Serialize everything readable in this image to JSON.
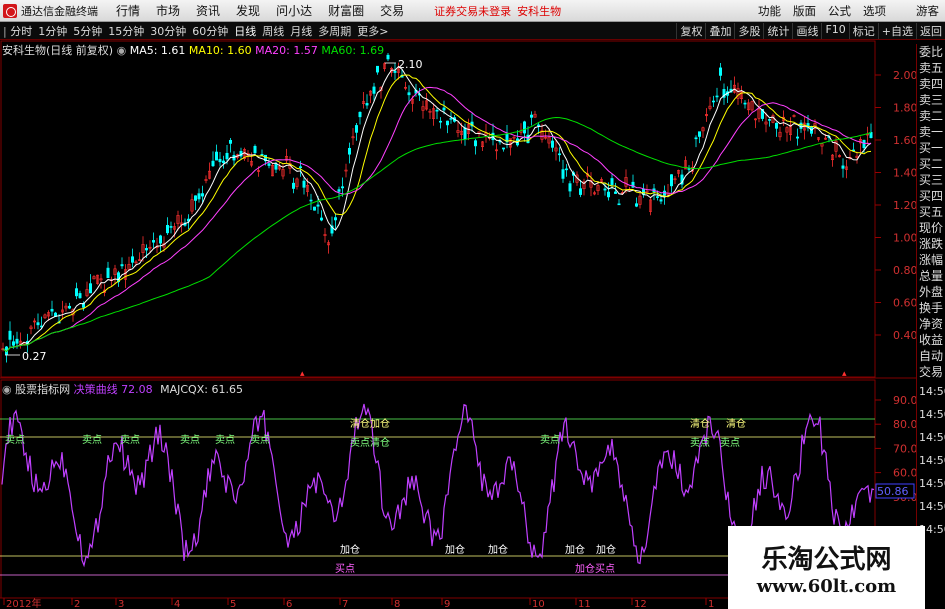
{
  "menubar": {
    "app_title": "通达信金融终端",
    "items": [
      "行情",
      "市场",
      "资讯",
      "发现",
      "问小达",
      "财富圈",
      "交易"
    ],
    "status": "证券交易未登录",
    "stock_tag": "安科生物",
    "right": [
      "功能",
      "版面",
      "公式",
      "选项",
      "游客"
    ]
  },
  "toolbar": {
    "periods": [
      "分时",
      "1分钟",
      "5分钟",
      "15分钟",
      "30分钟",
      "60分钟",
      "日线",
      "周线",
      "月线",
      "多周期",
      "更多"
    ],
    "more_arrow": ">",
    "right": [
      "复权",
      "叠加",
      "多股",
      "统计",
      "画线",
      "F10",
      "标记",
      "+自选",
      "返回"
    ]
  },
  "main_chart": {
    "title": "安科生物(日线 前复权)",
    "ma": [
      {
        "label": "MA5: 1.61",
        "color": "#ffffff"
      },
      {
        "label": "MA10: 1.60",
        "color": "#ffff00"
      },
      {
        "label": "MA20: 1.57",
        "color": "#ff40ff"
      },
      {
        "label": "MA60: 1.69",
        "color": "#00e000"
      }
    ],
    "high_label": "2.10",
    "low_label": "0.27",
    "y_ticks": [
      "2.00",
      "1.80",
      "1.60",
      "1.40",
      "1.20",
      "1.00",
      "0.80",
      "0.60",
      "0.40"
    ]
  },
  "indicator": {
    "title": "股票指标网",
    "name1": "决策曲线",
    "val1": "72.08",
    "name2": "MAJCQX",
    "val2": "61.65",
    "y_ticks": [
      "90.00",
      "80.00",
      "70.00",
      "60.00",
      "50.00"
    ],
    "current_value": "50.86",
    "labels": {
      "sell": "卖点",
      "clear": "清仓",
      "add": "加仓",
      "buy": "买点",
      "sell_clear": "卖点清仓",
      "clear_add": "清仓加仓",
      "add_buy": "加仓买点"
    }
  },
  "x_axis": [
    "2012年",
    "2",
    "3",
    "4",
    "5",
    "6",
    "7",
    "8",
    "9",
    "10",
    "11",
    "12",
    "1"
  ],
  "right_panel": {
    "items": [
      "委比",
      "卖五",
      "卖四",
      "卖三",
      "卖二",
      "卖一",
      "买一",
      "买二",
      "买三",
      "买四",
      "买五",
      "现价",
      "涨跌",
      "涨幅",
      "总量",
      "外盘",
      "换手",
      "净资",
      "收益",
      "自动",
      "交易"
    ],
    "times": [
      "14:50",
      "14:50",
      "14:50",
      "14:50",
      "14:50",
      "14:50",
      "14:50"
    ]
  },
  "watermark": {
    "line1": "乐淘公式网",
    "line2": "www.60lt.com"
  },
  "colors": {
    "up": "#ff3030",
    "down": "#00ffff",
    "ma5": "#ffffff",
    "ma10": "#ffff00",
    "ma20": "#ff40ff",
    "ma60": "#00e000",
    "indicator": "#c040ff"
  }
}
